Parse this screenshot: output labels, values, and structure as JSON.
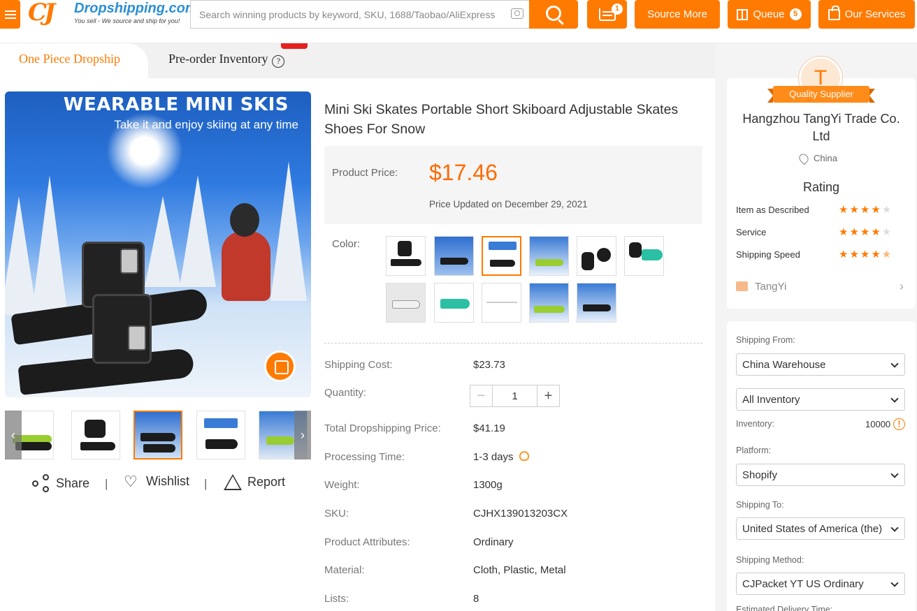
{
  "header": {
    "logo_name": "Dropshipping.com",
    "logo_tagline": "You sell - We source and ship for you!",
    "search_placeholder": "Search winning products by keyword, SKU, 1688/Taobao/AliExpress URL",
    "cart_count": "1",
    "source_more": "Source More",
    "queue": "Queue",
    "queue_count": "5",
    "services": "Our Services",
    "accent": "#ff7a00"
  },
  "tabs": [
    {
      "label": "One Piece Dropship",
      "active": true
    },
    {
      "label": "Pre-order Inventory",
      "active": false
    }
  ],
  "gallery": {
    "hero_title": "WEARABLE MINI SKIS",
    "hero_subtitle": "Take it and enjoy skiing at any time"
  },
  "actions": {
    "share": "Share",
    "wishlist": "Wishlist",
    "report": "Report"
  },
  "product": {
    "title": "Mini Ski Skates Portable Short Skiboard Adjustable Skates Shoes For Snow",
    "price_label": "Product Price:",
    "price": "$17.46",
    "price_updated": "Price Updated on December 29, 2021",
    "color_label": "Color:",
    "rows": [
      {
        "label": "Shipping Cost:",
        "value": "$23.73"
      },
      {
        "label": "Quantity:",
        "value": "1"
      },
      {
        "label": "Total Dropshipping Price:",
        "value": "$41.19"
      },
      {
        "label": "Processing Time:",
        "value": "1-3 days"
      },
      {
        "label": "Weight:",
        "value": "1300g"
      },
      {
        "label": "SKU:",
        "value": "CJHX139013203CX"
      },
      {
        "label": "Product Attributes:",
        "value": "Ordinary"
      },
      {
        "label": "Material:",
        "value": "Cloth, Plastic, Metal"
      },
      {
        "label": "Lists:",
        "value": "8"
      }
    ]
  },
  "supplier": {
    "avatar_letter": "T",
    "badge": "Quality Supplier",
    "name": "Hangzhou TangYi Trade Co. Ltd",
    "location": "China",
    "rating_title": "Rating",
    "ratings": [
      {
        "label": "Item as Described",
        "stars": 4
      },
      {
        "label": "Service",
        "stars": 4
      },
      {
        "label": "Shipping Speed",
        "stars": 4.5
      }
    ],
    "shop": "TangYi"
  },
  "shipping": {
    "from_label": "Shipping From:",
    "from_value": "China Warehouse",
    "inventory_select": "All Inventory",
    "inventory_label": "Inventory:",
    "inventory_value": "10000",
    "platform_label": "Platform:",
    "platform_value": "Shopify",
    "to_label": "Shipping To:",
    "to_value": "United States of America (the)",
    "method_label": "Shipping Method:",
    "method_value": "CJPacket YT US Ordinary",
    "estimated_label": "Estimated Delivery Time:"
  }
}
